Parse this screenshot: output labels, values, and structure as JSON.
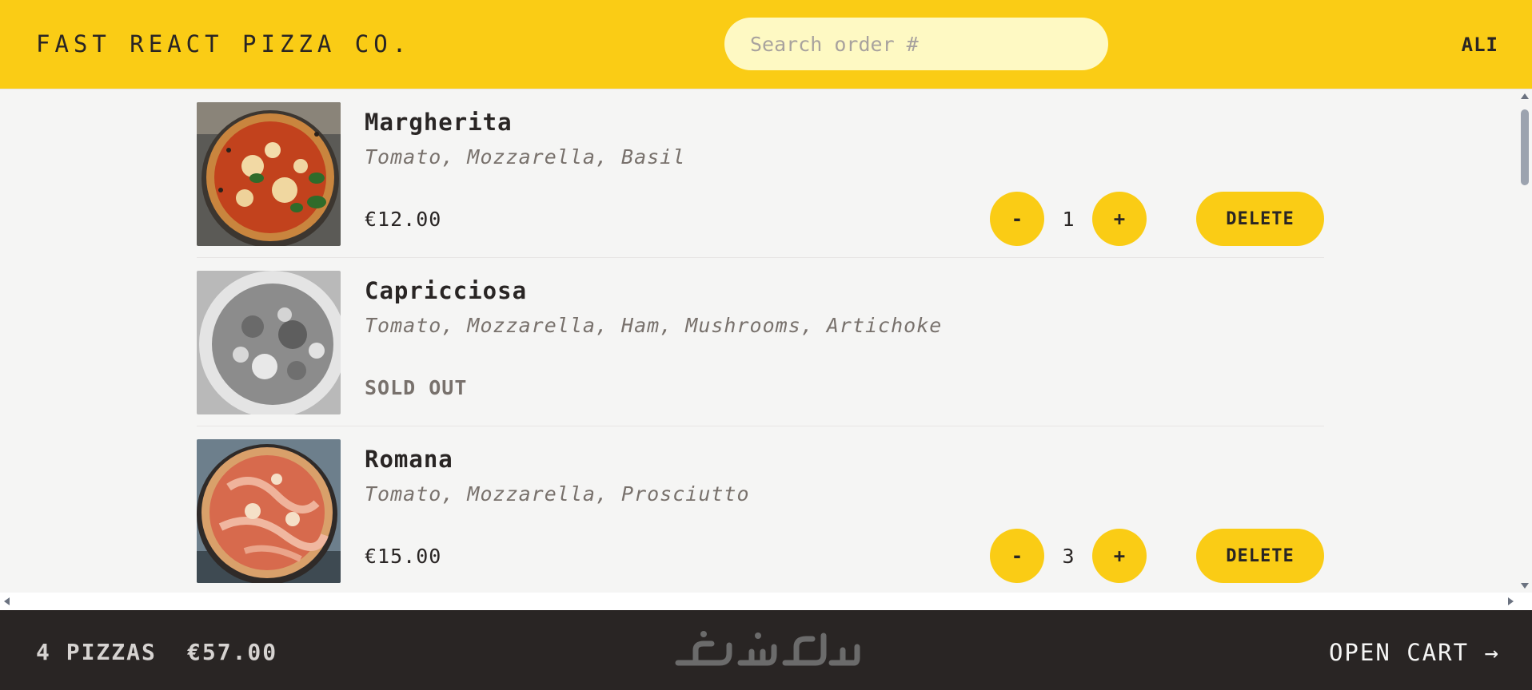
{
  "header": {
    "logo": "Fast React Pizza Co.",
    "search_placeholder": "Search order #",
    "user": "ALI"
  },
  "menu": [
    {
      "name": "Margherita",
      "ingredients": "Tomato, Mozzarella, Basil",
      "price": "€12.00",
      "sold_out": false,
      "quantity": "1",
      "delete_label": "DELETE"
    },
    {
      "name": "Capricciosa",
      "ingredients": "Tomato, Mozzarella, Ham, Mushrooms, Artichoke",
      "status": "SOLD OUT",
      "sold_out": true
    },
    {
      "name": "Romana",
      "ingredients": "Tomato, Mozzarella, Prosciutto",
      "price": "€15.00",
      "sold_out": false,
      "quantity": "3",
      "delete_label": "DELETE"
    }
  ],
  "controls": {
    "decrease": "-",
    "increase": "+"
  },
  "footer": {
    "count": "4 pizzas",
    "total": "€57.00",
    "open_cart": "Open cart →"
  },
  "colors": {
    "accent": "#facc15",
    "dark": "#292524",
    "background": "#f5f5f4",
    "search_bg": "#fef9c3"
  }
}
